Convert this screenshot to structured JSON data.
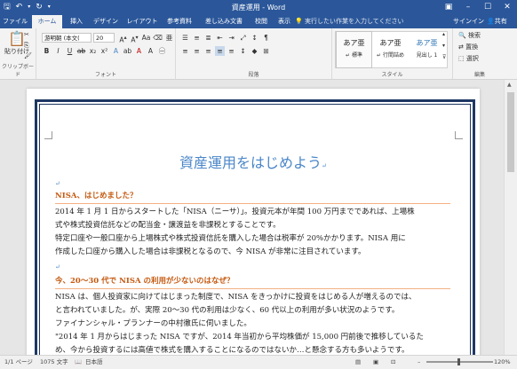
{
  "window": {
    "title": "資産運用 - Word"
  },
  "qat": {
    "save_icon": "save-icon",
    "undo_icon": "undo-icon",
    "redo_icon": "redo-icon"
  },
  "tabs": [
    {
      "label": "ファイル"
    },
    {
      "label": "ホーム"
    },
    {
      "label": "挿入"
    },
    {
      "label": "デザイン"
    },
    {
      "label": "レイアウト"
    },
    {
      "label": "参考資料"
    },
    {
      "label": "差し込み文書"
    },
    {
      "label": "校閲"
    },
    {
      "label": "表示"
    }
  ],
  "tellme": "実行したい作業を入力してください",
  "signin": "サインイン",
  "share": "共有",
  "ribbon": {
    "clipboard": {
      "paste": "貼り付け",
      "label": "クリップボード"
    },
    "font": {
      "name": "游明朝 (本文(",
      "size": "20",
      "label": "フォント"
    },
    "paragraph": {
      "label": "段落"
    },
    "styles": {
      "label": "スタイル",
      "items": [
        {
          "preview": "あア亜",
          "name": "↵ 標準"
        },
        {
          "preview": "あア亜",
          "name": "↵ 行間詰め"
        },
        {
          "preview": "あア亜",
          "name": "見出し 1"
        }
      ]
    },
    "editing": {
      "find": "検索",
      "replace": "置換",
      "select": "選択",
      "label": "編集"
    }
  },
  "document": {
    "title": "資産運用をはじめよう",
    "heading1": "NISA、はじめました？",
    "p1": "2014 年 1 月 1 日からスタートした「NISA（ニーサ）」。投資元本が年間 100 万円までであれば、上場株",
    "p2": "式や株式投資信託などの配当金・譲渡益を非課税とすることです。",
    "p3": "特定口座や一般口座から上場株式や株式投資信託を購入した場合は税率が 20%かかります。NISA 用に",
    "p4": "作成した口座から購入した場合は非課税となるので、今 NISA が非常に注目されています。",
    "heading2": "今、20～30 代で NISA の利用が少ないのはなぜ？",
    "p5": "NISA は、個人投資家に向けてはじまった制度で、NISA をきっかけに投資をはじめる人が増えるのでは、",
    "p6": "と言われていました。が、実際 20～30 代の利用は少なく、60 代以上の利用が多い状況のようです。",
    "p7": "ファイナンシャル・プランナーの中村徹氏に伺いました。",
    "p8": "\"2014 年 1 月からはじまった NISA ですが、2014 年当初から平均株価が 15,000 円前後で推移しているた",
    "p9": "め、今から投資するには高値で株式を購入することになるのではないか…と懸念する方も多いようです。"
  },
  "status": {
    "page": "1/1 ページ",
    "words": "1075 文字",
    "lang": "日本語",
    "zoom": "120%"
  }
}
